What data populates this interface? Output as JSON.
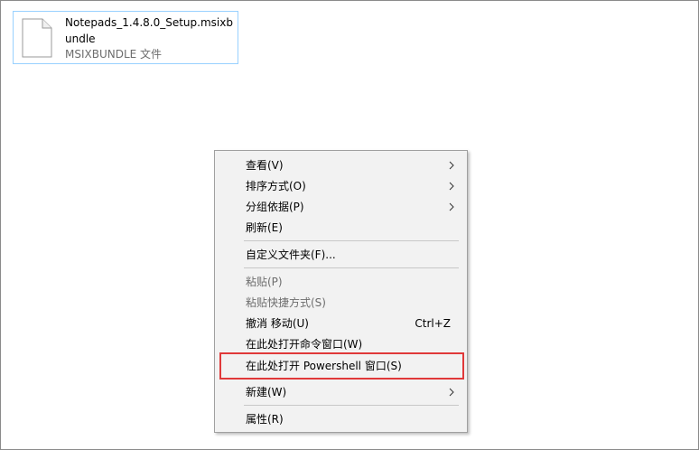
{
  "file": {
    "name": "Notepads_1.4.8.0_Setup.msixbundle",
    "type": "MSIXBUNDLE 文件"
  },
  "menu": {
    "items": [
      {
        "label": "查看(V)",
        "submenu": true
      },
      {
        "label": "排序方式(O)",
        "submenu": true
      },
      {
        "label": "分组依据(P)",
        "submenu": true
      },
      {
        "label": "刷新(E)"
      },
      {
        "label": "自定义文件夹(F)..."
      },
      {
        "label": "粘贴(P)",
        "disabled": true
      },
      {
        "label": "粘贴快捷方式(S)",
        "disabled": true
      },
      {
        "label": "撤消 移动(U)",
        "shortcut": "Ctrl+Z"
      },
      {
        "label": "在此处打开命令窗口(W)"
      },
      {
        "label": "在此处打开 Powershell 窗口(S)"
      },
      {
        "label": "新建(W)",
        "submenu": true
      },
      {
        "label": "属性(R)"
      }
    ]
  },
  "colors": {
    "selection_border": "#99d1ff",
    "menu_background": "#f2f2f2",
    "highlight_box": "#e0393a",
    "disabled_text": "#6d6d6d"
  },
  "icons": {
    "file": "document-icon",
    "submenu": "chevron-right-icon"
  }
}
